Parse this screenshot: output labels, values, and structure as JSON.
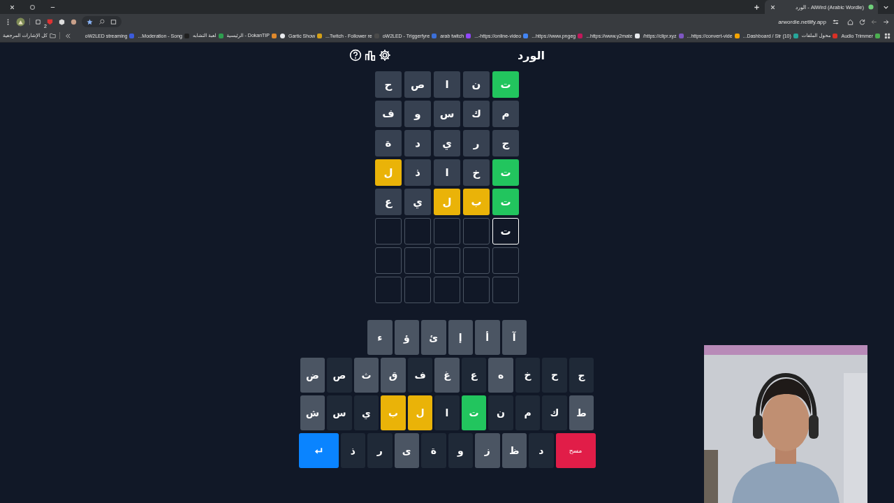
{
  "browser": {
    "tab": {
      "title": "AlWird (Arabic Wordle) - الورد"
    },
    "extension_badge": "2",
    "address": "arwordle.netlify.app",
    "bookmarks_folder": "كل الإشارات المرجعية",
    "bookmarks": [
      {
        "label": "Audio Trimmer",
        "color": "#4caf50"
      },
      {
        "label": "محول الملفات",
        "color": "#d93025"
      },
      {
        "label": "(10) Dashboard / Str...",
        "color": "#26a69a"
      },
      {
        "label": "https://convert-vide...",
        "color": "#f4a300"
      },
      {
        "label": "https://clipr.xyz/",
        "color": "#7e57c2"
      },
      {
        "label": "https://www.y2mate...",
        "color": "#e8eaed"
      },
      {
        "label": "https://www.pngeg...",
        "color": "#c2185b"
      },
      {
        "label": "https://online-video-...",
        "color": "#4285f4"
      },
      {
        "label": "arab twitch",
        "color": "#9146ff"
      },
      {
        "label": "oW2LED - Triggerfyre",
        "color": "#3b6fd8"
      },
      {
        "label": "Twitch - Follower re...",
        "color": "#4a4a4a"
      },
      {
        "label": "Gartic Show",
        "color": "#d4a017"
      },
      {
        "color": "#e8eaed"
      },
      {
        "label": "DokanTIP - الرئيسية",
        "color": "#e0892c"
      },
      {
        "label": "لعبة التشابه",
        "color": "#2e9d4f"
      },
      {
        "label": "Moderation - Song...",
        "color": "#202020"
      },
      {
        "label": "oW2LED streaming",
        "color": "#3b5bdb"
      }
    ]
  },
  "game": {
    "title": "الورد",
    "grid": [
      {
        "cells": [
          {
            "letter": "ت",
            "kind": "correct"
          },
          {
            "letter": "ن",
            "kind": "absent"
          },
          {
            "letter": "ا",
            "kind": "absent"
          },
          {
            "letter": "ص",
            "kind": "absent"
          },
          {
            "letter": "ح",
            "kind": "absent"
          }
        ]
      },
      {
        "cells": [
          {
            "letter": "م",
            "kind": "absent"
          },
          {
            "letter": "ك",
            "kind": "absent"
          },
          {
            "letter": "س",
            "kind": "absent"
          },
          {
            "letter": "و",
            "kind": "absent"
          },
          {
            "letter": "ف",
            "kind": "absent"
          }
        ]
      },
      {
        "cells": [
          {
            "letter": "ج",
            "kind": "absent"
          },
          {
            "letter": "ر",
            "kind": "absent"
          },
          {
            "letter": "ي",
            "kind": "absent"
          },
          {
            "letter": "د",
            "kind": "absent"
          },
          {
            "letter": "ة",
            "kind": "absent"
          }
        ]
      },
      {
        "cells": [
          {
            "letter": "ت",
            "kind": "correct"
          },
          {
            "letter": "خ",
            "kind": "absent"
          },
          {
            "letter": "ا",
            "kind": "absent"
          },
          {
            "letter": "ذ",
            "kind": "absent"
          },
          {
            "letter": "ل",
            "kind": "present"
          }
        ]
      },
      {
        "cells": [
          {
            "letter": "ت",
            "kind": "correct"
          },
          {
            "letter": "ب",
            "kind": "present"
          },
          {
            "letter": "ل",
            "kind": "present"
          },
          {
            "letter": "ي",
            "kind": "absent"
          },
          {
            "letter": "ع",
            "kind": "absent"
          }
        ]
      },
      {
        "cells": [
          {
            "letter": "ت",
            "kind": "typed"
          },
          {
            "kind": "empty"
          },
          {
            "kind": "empty"
          },
          {
            "kind": "empty"
          },
          {
            "kind": "empty"
          }
        ]
      },
      {
        "cells": [
          {
            "kind": "empty"
          },
          {
            "kind": "empty"
          },
          {
            "kind": "empty"
          },
          {
            "kind": "empty"
          },
          {
            "kind": "empty"
          }
        ]
      },
      {
        "cells": [
          {
            "kind": "empty"
          },
          {
            "kind": "empty"
          },
          {
            "kind": "empty"
          },
          {
            "kind": "empty"
          },
          {
            "kind": "empty"
          }
        ]
      }
    ],
    "keyboard": [
      {
        "keys": [
          {
            "kind": "unused",
            "label": "آ"
          },
          {
            "kind": "unused",
            "label": "أ"
          },
          {
            "kind": "unused",
            "label": "إ"
          },
          {
            "kind": "unused",
            "label": "ئ"
          },
          {
            "kind": "unused",
            "label": "ؤ"
          },
          {
            "kind": "unused",
            "label": "ء"
          }
        ]
      },
      {
        "keys": [
          {
            "kind": "absent",
            "label": "ج"
          },
          {
            "kind": "absent",
            "label": "ح"
          },
          {
            "kind": "absent",
            "label": "خ"
          },
          {
            "kind": "unused",
            "label": "ه"
          },
          {
            "kind": "absent",
            "label": "ع"
          },
          {
            "kind": "unused",
            "label": "غ"
          },
          {
            "kind": "absent",
            "label": "ف"
          },
          {
            "kind": "unused",
            "label": "ق"
          },
          {
            "kind": "unused",
            "label": "ث"
          },
          {
            "kind": "absent",
            "label": "ص"
          },
          {
            "kind": "unused",
            "label": "ض"
          }
        ]
      },
      {
        "keys": [
          {
            "kind": "unused",
            "label": "ط"
          },
          {
            "kind": "absent",
            "label": "ك"
          },
          {
            "kind": "absent",
            "label": "م"
          },
          {
            "kind": "absent",
            "label": "ن"
          },
          {
            "kind": "correct",
            "label": "ت"
          },
          {
            "kind": "absent",
            "label": "ا"
          },
          {
            "kind": "present",
            "label": "ل"
          },
          {
            "kind": "present",
            "label": "ب"
          },
          {
            "kind": "absent",
            "label": "ي"
          },
          {
            "kind": "absent",
            "label": "س"
          },
          {
            "kind": "unused",
            "label": "ش"
          }
        ]
      },
      {
        "keys": [
          {
            "kind": "delete",
            "label": "مسح"
          },
          {
            "kind": "absent",
            "label": "د"
          },
          {
            "kind": "unused",
            "label": "ظ"
          },
          {
            "kind": "unused",
            "label": "ز"
          },
          {
            "kind": "absent",
            "label": "و"
          },
          {
            "kind": "absent",
            "label": "ة"
          },
          {
            "kind": "unused",
            "label": "ى"
          },
          {
            "kind": "absent",
            "label": "ر"
          },
          {
            "kind": "absent",
            "label": "ذ"
          },
          {
            "kind": "enter"
          }
        ]
      }
    ]
  }
}
